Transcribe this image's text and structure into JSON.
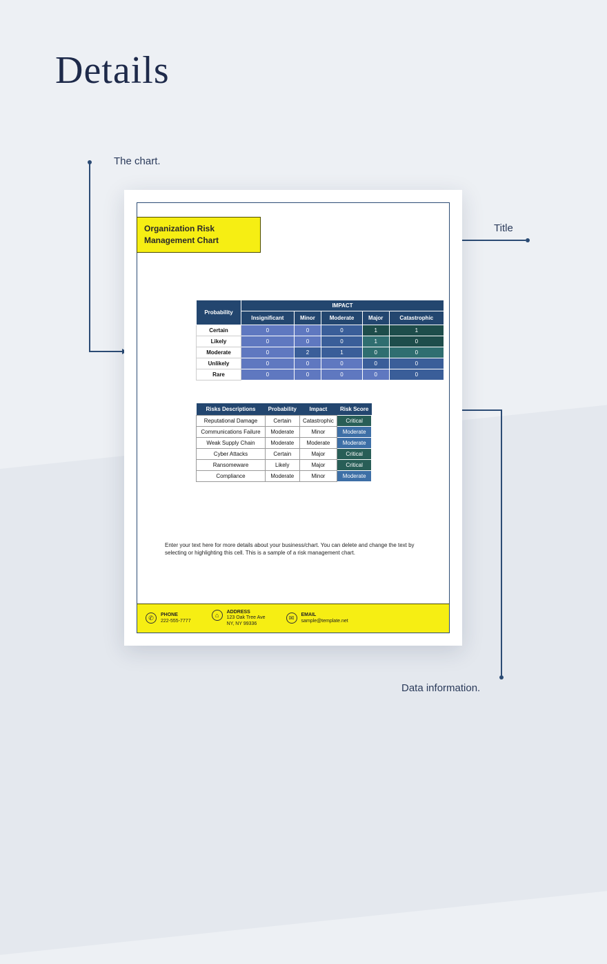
{
  "heading": "Details",
  "annotations": {
    "chart": "The chart.",
    "title": "Title",
    "data": "Data information."
  },
  "document": {
    "title": "Organization Risk Management Chart",
    "matrix": {
      "row_header": "Probability",
      "col_superheader": "IMPACT",
      "columns": [
        "Insignificant",
        "Minor",
        "Moderate",
        "Major",
        "Catastrophic"
      ],
      "rows": [
        {
          "label": "Certain",
          "cells": [
            "0",
            "0",
            "0",
            "1",
            "1"
          ],
          "classes": [
            "c-blue",
            "c-blue",
            "c-dblue",
            "c-dteal",
            "c-dteal"
          ]
        },
        {
          "label": "Likely",
          "cells": [
            "0",
            "0",
            "0",
            "1",
            "0"
          ],
          "classes": [
            "c-blue",
            "c-blue",
            "c-dblue",
            "c-teal",
            "c-dteal"
          ]
        },
        {
          "label": "Moderate",
          "cells": [
            "0",
            "2",
            "1",
            "0",
            "0"
          ],
          "classes": [
            "c-blue",
            "c-dblue",
            "c-dblue",
            "c-teal",
            "c-teal"
          ]
        },
        {
          "label": "Unlikely",
          "cells": [
            "0",
            "0",
            "0",
            "0",
            "0"
          ],
          "classes": [
            "c-blue",
            "c-blue",
            "c-blue",
            "c-dblue",
            "c-dblue"
          ]
        },
        {
          "label": "Rare",
          "cells": [
            "0",
            "0",
            "0",
            "0",
            "0"
          ],
          "classes": [
            "c-blue",
            "c-blue",
            "c-blue",
            "c-blue",
            "c-dblue"
          ]
        }
      ]
    },
    "risks": {
      "headers": [
        "Risks Descriptions",
        "Probability",
        "Impact",
        "Risk Score"
      ],
      "rows": [
        {
          "cells": [
            "Reputational Damage",
            "Certain",
            "Catastrophic"
          ],
          "score": "Critical",
          "scoreClass": "score-crit"
        },
        {
          "cells": [
            "Communications Failure",
            "Moderate",
            "Minor"
          ],
          "score": "Moderate",
          "scoreClass": "score-mod"
        },
        {
          "cells": [
            "Weak Supply Chain",
            "Moderate",
            "Moderate"
          ],
          "score": "Moderate",
          "scoreClass": "score-mod"
        },
        {
          "cells": [
            "Cyber Attacks",
            "Certain",
            "Major"
          ],
          "score": "Critical",
          "scoreClass": "score-crit"
        },
        {
          "cells": [
            "Ransomeware",
            "Likely",
            "Major"
          ],
          "score": "Critical",
          "scoreClass": "score-crit"
        },
        {
          "cells": [
            "Compliance",
            "Moderate",
            "Minor"
          ],
          "score": "Moderate",
          "scoreClass": "score-mod"
        }
      ]
    },
    "description": "Enter your text here for more details about your business/chart. You can delete and change the text by selecting or highlighting this cell. This is a sample of a risk management chart.",
    "footer": {
      "phone": {
        "label": "PHONE",
        "value": "222-555-7777",
        "glyph": "✆"
      },
      "address": {
        "label": "ADDRESS",
        "line1": "123 Oak Tree Ave",
        "line2": "NY, NY 99336",
        "glyph": "⌂"
      },
      "email": {
        "label": "EMAIL",
        "value": "sample@template.net",
        "glyph": "✉"
      }
    }
  }
}
